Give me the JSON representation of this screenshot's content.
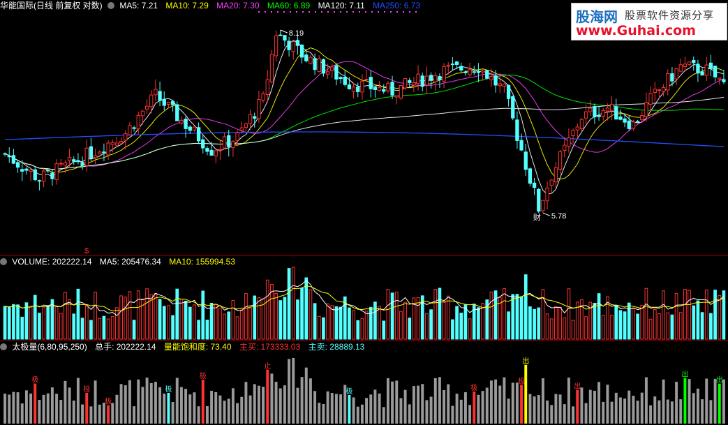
{
  "header1": {
    "title": "华能国际(日线 前复权 对数)",
    "ma5": "MA5: 7.21",
    "ma10": "MA10: 7.29",
    "ma20": "MA20: 7.30",
    "ma60": "MA60: 6.89",
    "ma120": "MA120: 7.11",
    "ma250": "MA250: 6.73"
  },
  "header2": {
    "title": "VOLUME: 202222.14",
    "ma5": "MA5: 205476.34",
    "ma10": "MA10: 155994.53"
  },
  "header3": {
    "title": "太极量(6,80,95,250)",
    "total": "总手: 202222.14",
    "saturation": "量能饱和度: 73.40",
    "buy": "主买: 173333.03",
    "sell": "主卖: 28889.13"
  },
  "logo": {
    "line1": "股海网",
    "line2": "股票软件资源分享",
    "line3": "www.Guhai.com"
  },
  "colors": {
    "up": "#ff3232",
    "down": "#54ffff",
    "ma5": "#ffffff",
    "ma10": "#ffff00",
    "ma20": "#ff40ff",
    "ma60": "#00ff00",
    "ma120": "#ffffff",
    "ma250": "#2050ff",
    "grey": "#9a9a9a",
    "separator": "#a00000"
  },
  "chart_data": {
    "type": "candlestick",
    "price_labels": {
      "high": "8.19",
      "low": "5.78",
      "low_tag": "财",
      "mark": "$"
    },
    "price_high": 8.19,
    "price_low": 5.78,
    "volume_signals": [
      "极",
      "极",
      "极",
      "极",
      "极",
      "止",
      "极",
      "极",
      "极",
      "出",
      "出"
    ]
  }
}
